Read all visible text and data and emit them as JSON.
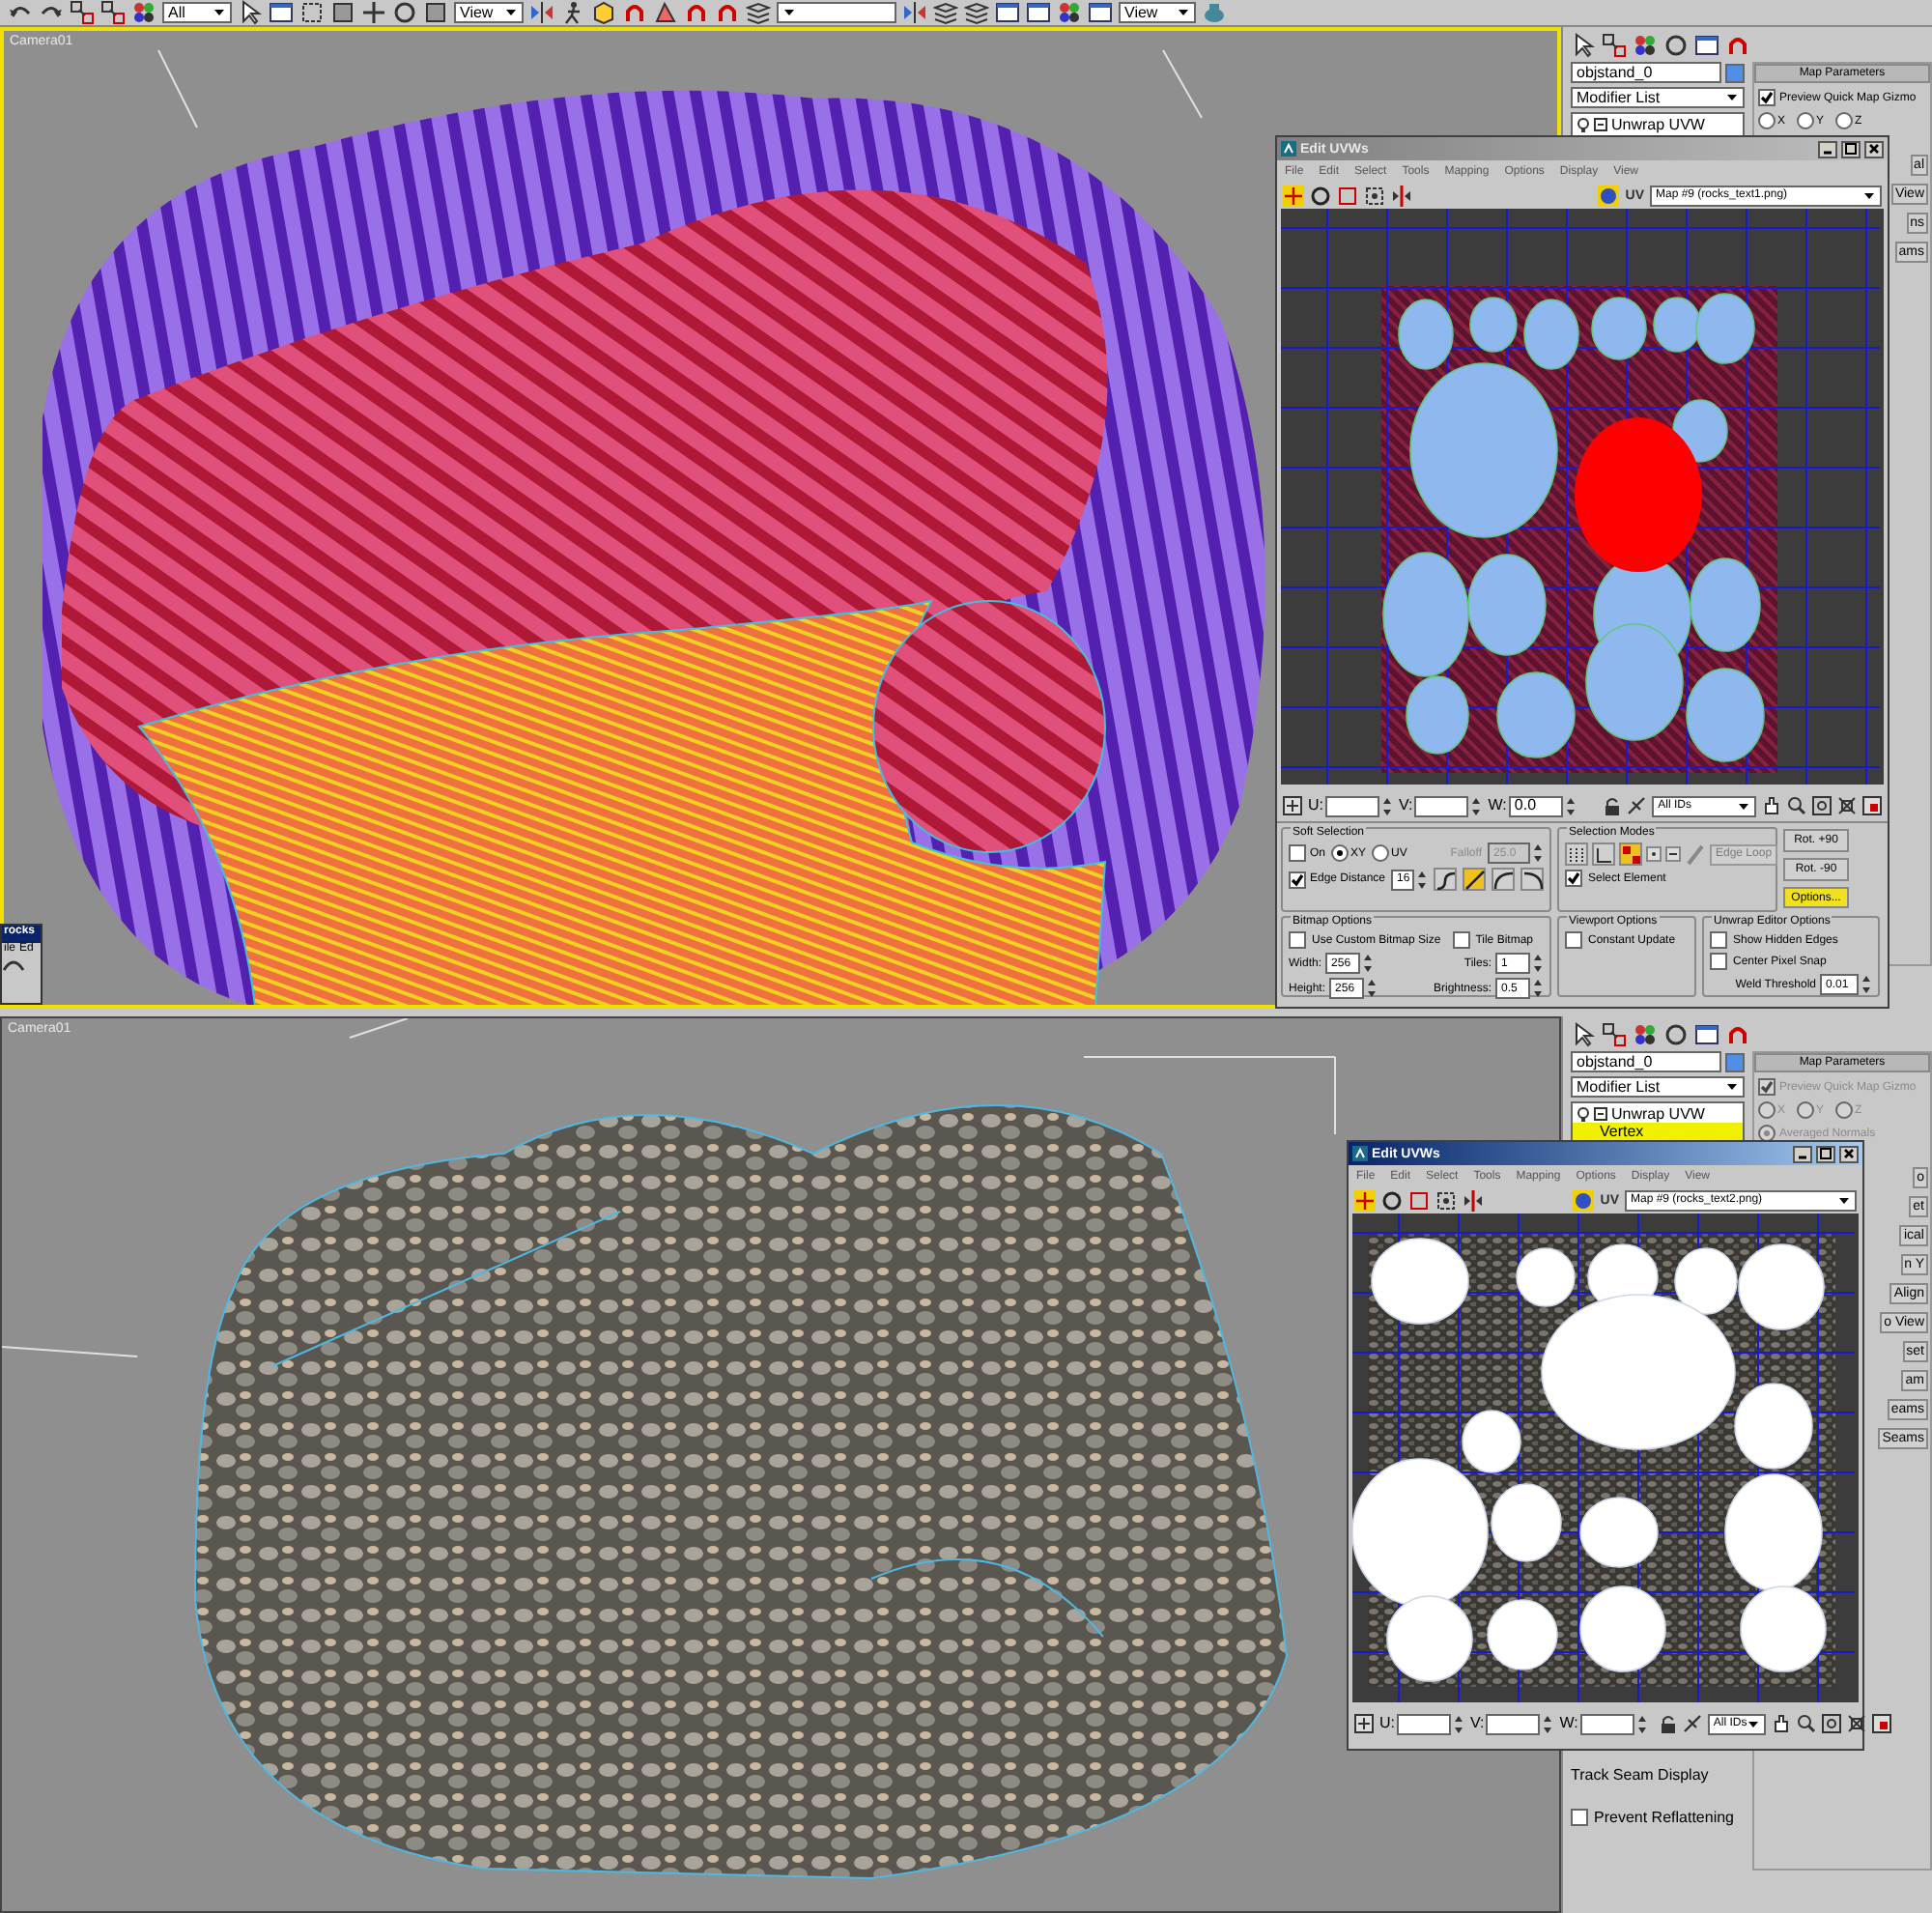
{
  "toolbar": {
    "dropdowns": [
      "All",
      "View",
      "View"
    ]
  },
  "viewports": [
    {
      "label": "Camera01",
      "kind": "striped",
      "active": true
    },
    {
      "label": "Camera01",
      "kind": "rocks",
      "active": false
    }
  ],
  "floating_window": {
    "title": "rocks",
    "menu": [
      "ile",
      "Ed"
    ]
  },
  "command_panels": [
    {
      "object_name": "objstand_0",
      "modifier_list": "Modifier List",
      "stack": [
        {
          "label": "Unwrap UVW",
          "selected": false
        }
      ],
      "rollout_title": "Map Parameters",
      "preview": {
        "label": "Preview Quick Map Gizmo",
        "checked": true,
        "disabled": false
      },
      "axes": [
        {
          "label": "X",
          "selected": false
        },
        {
          "label": "Y",
          "selected": false
        },
        {
          "label": "Z",
          "selected": false
        }
      ],
      "cut_buttons": [
        "al",
        "View",
        "ns",
        "ams"
      ]
    },
    {
      "object_name": "objstand_0",
      "modifier_list": "Modifier List",
      "stack": [
        {
          "label": "Unwrap UVW",
          "selected": false
        },
        {
          "label": "Vertex",
          "selected": true
        }
      ],
      "rollout_title": "Map Parameters",
      "preview": {
        "label": "Preview Quick Map Gizmo",
        "checked": true,
        "disabled": true
      },
      "axes": [
        {
          "label": "X",
          "selected": false
        },
        {
          "label": "Y",
          "selected": false
        },
        {
          "label": "Z",
          "selected": false
        }
      ],
      "averaged_normals": {
        "label": "Averaged Normals",
        "checked": true,
        "disabled": true
      },
      "cut_buttons": [
        "o",
        "et",
        "ical",
        "n Y",
        "Align",
        "o View",
        "set",
        "am",
        "eams",
        "Seams"
      ],
      "track_seams": {
        "label": "Track Seam Display"
      },
      "prevent_reflattening": {
        "label": "Prevent Reflattening",
        "checked": false
      }
    }
  ],
  "uv_editors": [
    {
      "title": "Edit UVWs",
      "active": false,
      "kind": "striped",
      "menu": [
        "File",
        "Edit",
        "Select",
        "Tools",
        "Mapping",
        "Options",
        "Display",
        "View"
      ],
      "uv_label": "UV",
      "map": "Map #9 (rocks_text1.png)",
      "coords": [
        {
          "label": "U:"
        },
        {
          "label": "V:"
        },
        {
          "label": "W:",
          "value": "0.0"
        }
      ],
      "ids": "All IDs",
      "options": {
        "soft_selection": {
          "title": "Soft Selection",
          "on": {
            "label": "On",
            "checked": false
          },
          "modes": [
            {
              "label": "XY",
              "selected": true
            },
            {
              "label": "UV",
              "selected": false
            }
          ],
          "falloff": {
            "label": "Falloff",
            "value": "25.0",
            "disabled": true
          },
          "edge_distance": {
            "label": "Edge Distance",
            "checked": true,
            "value": "16"
          },
          "curves": [
            {
              "selected": false
            },
            {
              "selected": true
            },
            {
              "selected": false
            },
            {
              "selected": false
            }
          ]
        },
        "selection_modes": {
          "title": "Selection Modes",
          "modes": [
            {
              "selected": false
            },
            {
              "selected": false
            },
            {
              "selected": true
            }
          ],
          "edge_loop": {
            "label": "Edge Loop",
            "disabled": true
          },
          "select_element": {
            "label": "Select Element",
            "checked": true
          }
        },
        "rotate_buttons": [
          "Rot. +90",
          "Rot. -90"
        ],
        "options_button": {
          "label": "Options...",
          "selected": true
        },
        "bitmap_options": {
          "title": "Bitmap Options",
          "use_custom": {
            "label": "Use Custom Bitmap Size",
            "checked": false
          },
          "tile": {
            "label": "Tile Bitmap",
            "checked": false
          },
          "width": {
            "label": "Width:",
            "value": "256"
          },
          "height": {
            "label": "Height:",
            "value": "256"
          },
          "tiles": {
            "label": "Tiles:",
            "value": "1"
          },
          "brightness": {
            "label": "Brightness:",
            "value": "0.5"
          }
        },
        "viewport_options": {
          "title": "Viewport Options",
          "constant_update": {
            "label": "Constant Update",
            "checked": false
          }
        },
        "editor_options": {
          "title": "Unwrap Editor Options",
          "hidden_edges": {
            "label": "Show Hidden Edges",
            "checked": false
          },
          "pixel_snap": {
            "label": "Center Pixel Snap",
            "checked": false
          },
          "weld": {
            "label": "Weld Threshold",
            "value": "0.01"
          }
        }
      }
    },
    {
      "title": "Edit UVWs",
      "active": true,
      "kind": "rocks",
      "menu": [
        "File",
        "Edit",
        "Select",
        "Tools",
        "Mapping",
        "Options",
        "Display",
        "View"
      ],
      "uv_label": "UV",
      "map": "Map #9 (rocks_text2.png)",
      "coords": [
        {
          "label": "U:"
        },
        {
          "label": "V:"
        },
        {
          "label": "W:"
        }
      ],
      "ids": "All IDs"
    }
  ]
}
